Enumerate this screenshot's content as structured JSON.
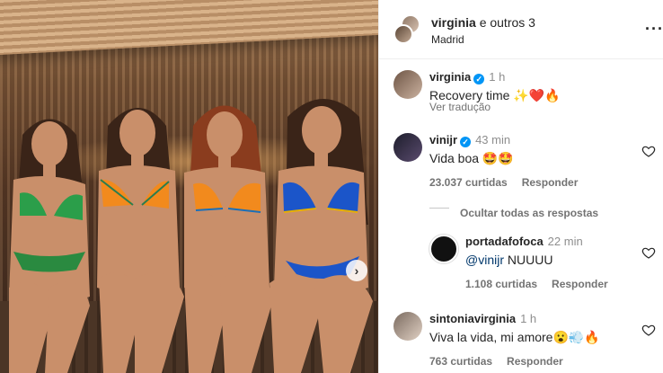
{
  "post": {
    "header_user": "virginia",
    "header_others": "e outros 3",
    "location": "Madrid"
  },
  "comments": [
    {
      "user": "virginia",
      "verified": true,
      "time": "1 h",
      "text": "Recovery time ✨❤️🔥",
      "translate": "Ver tradução"
    },
    {
      "user": "vinijr",
      "verified": true,
      "time": "43 min",
      "text": "Vida boa 🤩🤩",
      "likes": "23.037 curtidas",
      "reply": "Responder",
      "hide_replies": "Ocultar todas as respostas"
    },
    {
      "user": "portadafofoca",
      "verified": false,
      "time": "22 min",
      "mention": "@vinijr",
      "text": "NUUUU",
      "likes": "1.108 curtidas",
      "reply": "Responder"
    },
    {
      "user": "sintoniavirginia",
      "verified": false,
      "time": "1 h",
      "text": "Viva la vida, mi amore😮💨🔥",
      "likes": "763 curtidas",
      "reply": "Responder"
    }
  ],
  "icons": {
    "more": "more-options-icon",
    "next": "chevron-right-icon",
    "like": "heart-icon",
    "verified": "verified-badge-icon"
  },
  "colors": {
    "verified": "#0095f6",
    "mention": "#00376b",
    "muted": "#737373"
  }
}
